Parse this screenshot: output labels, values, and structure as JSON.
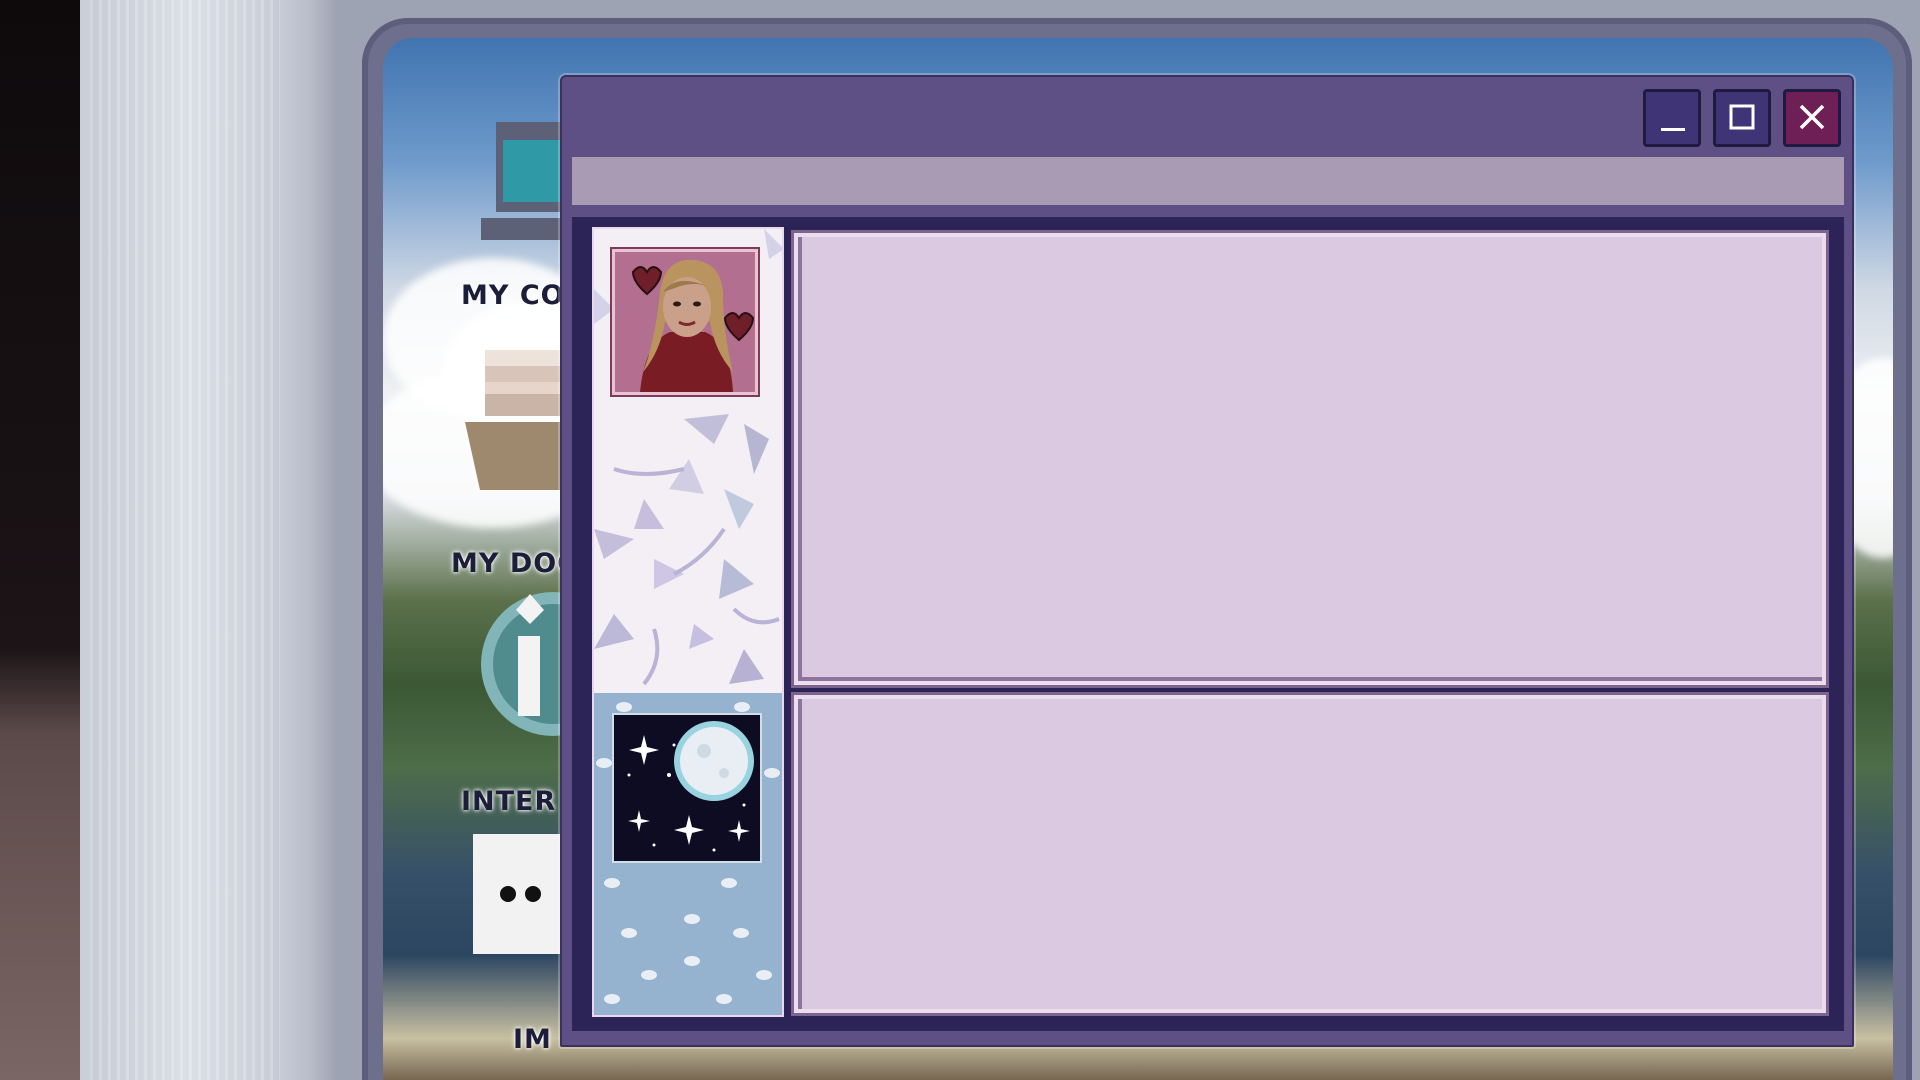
{
  "desktop": {
    "icons": [
      {
        "label": "MY COM",
        "icon": "computer-icon"
      },
      {
        "label": "MY DOCU",
        "icon": "documents-icon"
      },
      {
        "label": "INTER",
        "icon": "internet-icon"
      },
      {
        "label": "IM",
        "icon": "messenger-icon"
      }
    ]
  },
  "window": {
    "controls": {
      "minimize_icon": "minimize-icon",
      "maximize_icon": "maximize-icon",
      "close_icon": "close-icon"
    },
    "sidebar": {
      "profile_image": "profile-portrait-woman-hearts",
      "status_image": "night-sky-moon"
    }
  },
  "colors": {
    "window_frame": "#5e4f84",
    "menubar": "#a99bb4",
    "content_bg": "#2c2356",
    "panel_bg": "#dbc8e1",
    "close_button": "#6e2056",
    "button": "#3f3476"
  }
}
